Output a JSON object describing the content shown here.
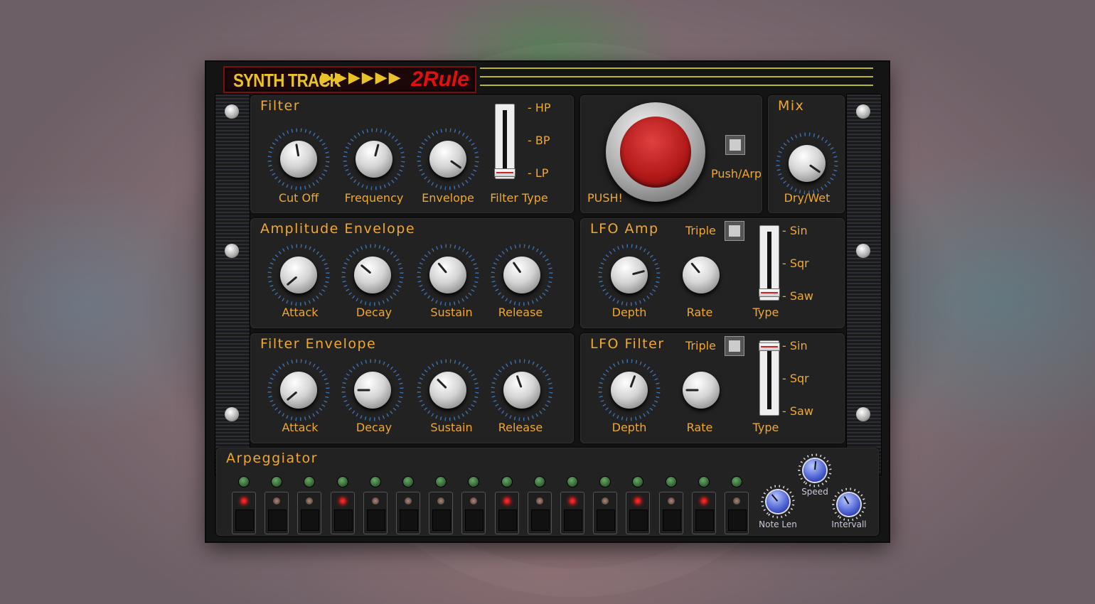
{
  "header": {
    "brand": "SYNTH TRACK",
    "arrows": "▶▶▶▶▶▶",
    "brand2": "2Rule"
  },
  "filter": {
    "title": "Filter",
    "knobs": [
      {
        "label": "Cut Off"
      },
      {
        "label": "Frequency"
      },
      {
        "label": "Envelope"
      }
    ],
    "type_label": "Filter Type",
    "type_options": [
      "- HP",
      "- BP",
      "- LP"
    ]
  },
  "push": {
    "label": "PUSH!",
    "toggle_label": "Push/Arp"
  },
  "mix": {
    "title": "Mix",
    "knob_label": "Dry/Wet"
  },
  "amp_env": {
    "title": "Amplitude Envelope",
    "knobs": [
      {
        "label": "Attack"
      },
      {
        "label": "Decay"
      },
      {
        "label": "Sustain"
      },
      {
        "label": "Release"
      }
    ]
  },
  "lfo_amp": {
    "title": "LFO Amp",
    "triple_label": "Triple",
    "depth_label": "Depth",
    "rate_label": "Rate",
    "type_label": "Type",
    "type_options": [
      "- Sin",
      "- Sqr",
      "- Saw"
    ]
  },
  "filter_env": {
    "title": "Filter Envelope",
    "knobs": [
      {
        "label": "Attack"
      },
      {
        "label": "Decay"
      },
      {
        "label": "Sustain"
      },
      {
        "label": "Release"
      }
    ]
  },
  "lfo_filter": {
    "title": "LFO Filter",
    "triple_label": "Triple",
    "depth_label": "Depth",
    "rate_label": "Rate",
    "type_label": "Type",
    "type_options": [
      "- Sin",
      "- Sqr",
      "- Saw"
    ]
  },
  "arp": {
    "title": "Arpeggiator",
    "steps_on": [
      true,
      false,
      false,
      true,
      false,
      false,
      false,
      false,
      true,
      false,
      true,
      false,
      true,
      false,
      true,
      false
    ],
    "note_len_label": "Note Len",
    "speed_label": "Speed",
    "intervall_label": "Intervall"
  },
  "colors": {
    "label": "#f0a830",
    "accent_red": "#e01010",
    "brand_yellow": "#e9c22a"
  }
}
